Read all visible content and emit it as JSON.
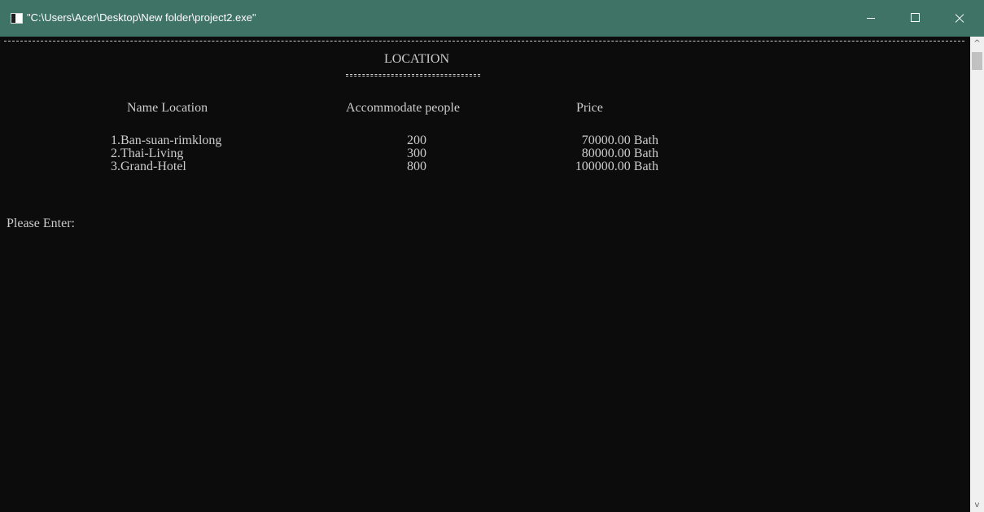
{
  "window": {
    "title": "\"C:\\Users\\Acer\\Desktop\\New folder\\project2.exe\"",
    "titlebar_color": "#3f7366",
    "background_color": "#0c0c0c",
    "text_color": "#cccccc",
    "buttons": {
      "minimize_icon": "minimize-icon",
      "maximize_icon": "maximize-icon",
      "close_icon": "close-icon"
    }
  },
  "console": {
    "heading": "LOCATION",
    "columns": {
      "name": "Name Location",
      "capacity": "Accommodate people",
      "price": "Price"
    },
    "rows": [
      {
        "name": "1.Ban-suan-rimklong",
        "capacity": "200",
        "price": "70000.00 Bath"
      },
      {
        "name": "2.Thai-Living",
        "capacity": "300",
        "price": "80000.00 Bath"
      },
      {
        "name": "3.Grand-Hotel",
        "capacity": "800",
        "price": "100000.00 Bath"
      }
    ],
    "prompt": "Please Enter:"
  },
  "scrollbar": {
    "up_icon": "^",
    "down_icon": "v"
  }
}
